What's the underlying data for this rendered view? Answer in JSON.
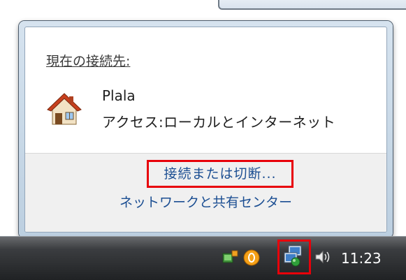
{
  "popup": {
    "header": "現在の接続先:",
    "network": {
      "name": "Plala",
      "access": "アクセス:ローカルとインターネット",
      "icon": "house-icon"
    },
    "disconnect_link": "接続または切断...",
    "network_center_link": "ネットワークと共有センター"
  },
  "taskbar": {
    "tray_icons": [
      "network-adapter-icon",
      "shield-o-icon",
      "network-status-icon",
      "volume-icon"
    ],
    "clock": "11:23"
  },
  "colors": {
    "highlight": "#e8000a",
    "link": "#1b4e92"
  }
}
